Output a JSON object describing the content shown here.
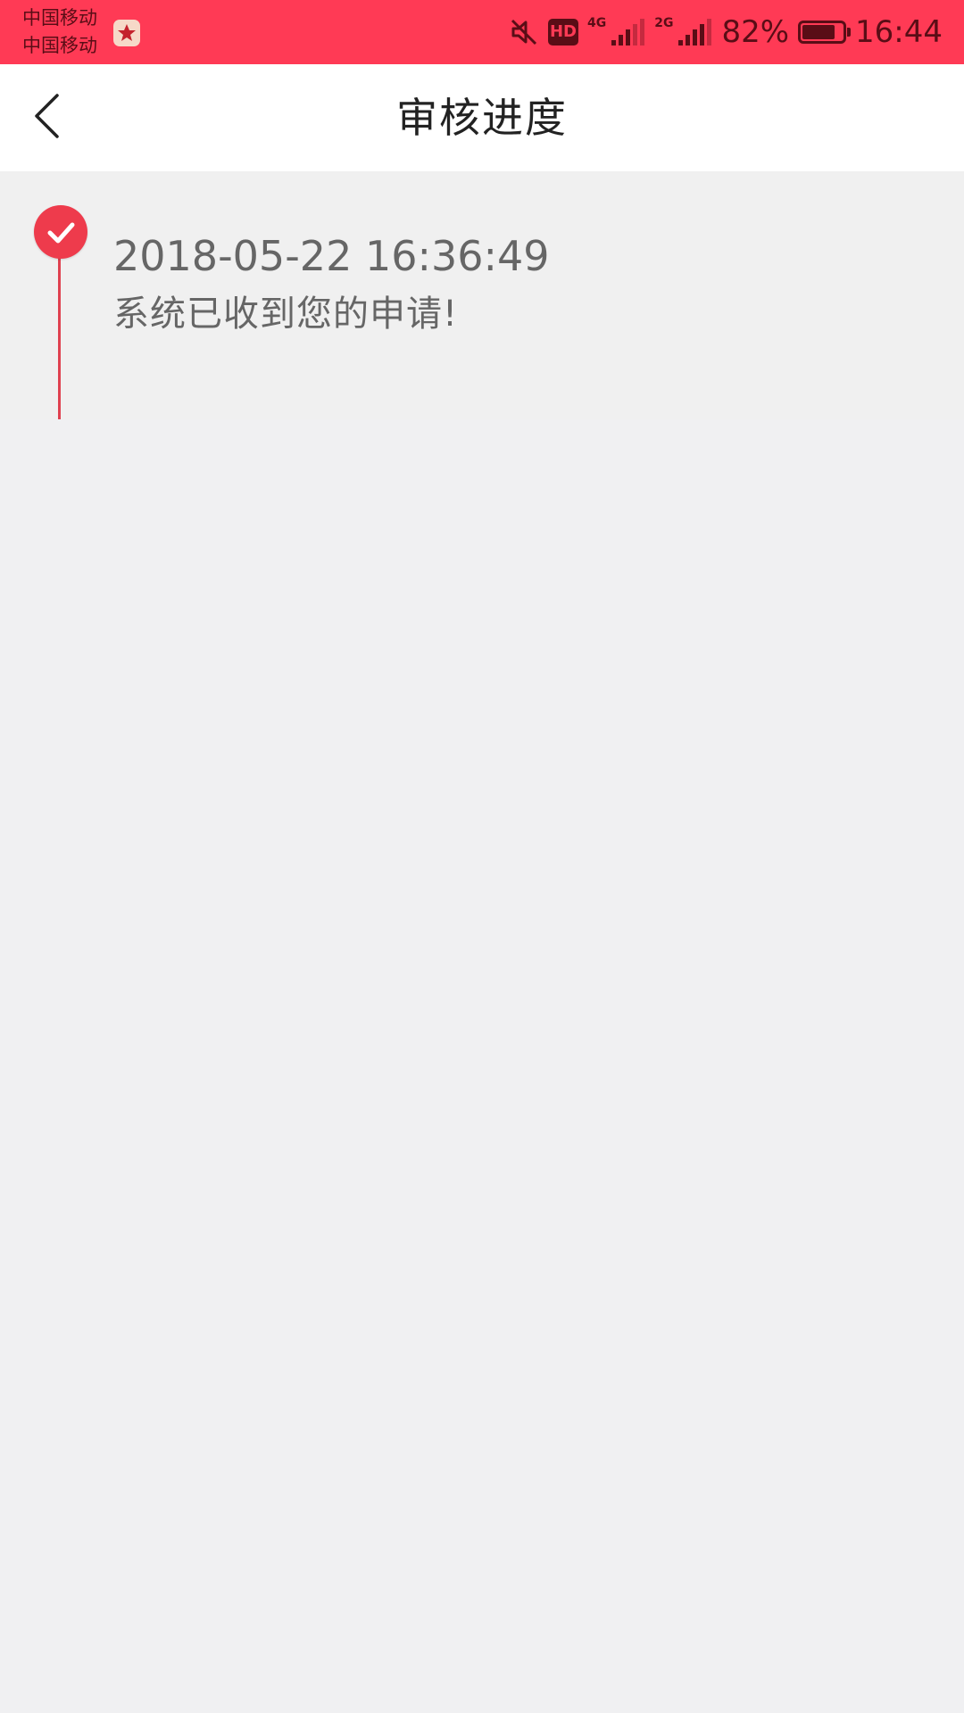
{
  "status_bar": {
    "carriers": [
      "中国移动",
      "中国移动"
    ],
    "app_notification_icon": "app-notification-icon",
    "icons": [
      "mute-icon",
      "hd-icon",
      "signal-4g-icon",
      "signal-2g-icon",
      "battery-icon"
    ],
    "hd_label": "HD",
    "net_4g": "4G",
    "net_2g": "2G",
    "battery_percent": "82%",
    "battery_level": 0.82,
    "time": "16:44",
    "background_color": "#ff3a55"
  },
  "nav": {
    "back_icon": "chevron-left-icon",
    "title": "审核进度"
  },
  "timeline": {
    "accent_color": "#ee3b4c",
    "entries": [
      {
        "icon": "check-icon",
        "time": "2018-05-22 16:36:49",
        "description": "系统已收到您的申请!"
      }
    ]
  }
}
